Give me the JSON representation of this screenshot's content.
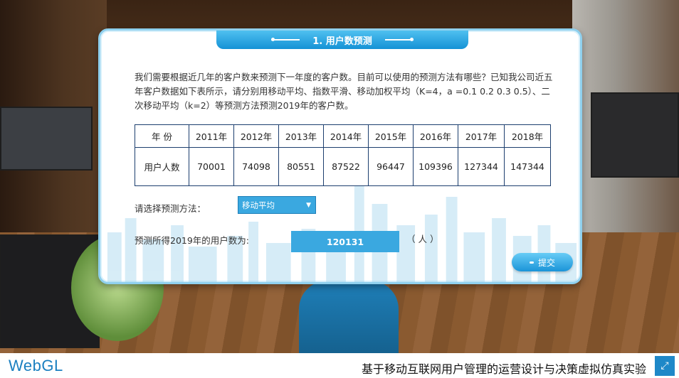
{
  "dialog": {
    "title": "1. 用户数预测",
    "question": "我们需要根据近几年的客户数来预测下一年度的客户数。目前可以使用的预测方法有哪些？已知我公司近五年客户数据如下表所示，请分别用移动平均、指数平滑、移动加权平均（K=4，a =0.1 0.2  0.3 0.5）、二次移动平均（k=2）等预测方法预测2019年的客户数。",
    "table": {
      "row1_header": "年 份",
      "years": [
        "2011年",
        "2012年",
        "2013年",
        "2014年",
        "2015年",
        "2016年",
        "2017年",
        "2018年"
      ],
      "row2_header": "用户人数",
      "users": [
        "70001",
        "74098",
        "80551",
        "87522",
        "96447",
        "109396",
        "127344",
        "147344"
      ]
    },
    "method_label": "请选择预测方法：",
    "method_selected": "移动平均",
    "result_label": "预测所得2019年的用户数为:",
    "result_value": "120131",
    "unit": "（ 人 ）",
    "submit_label": "提交"
  },
  "footer": {
    "brand": "WebGL",
    "project_title": "基于移动互联网用户管理的运营设计与决策虚拟仿真实验",
    "fullscreen_icon": "expand-icon"
  },
  "colors": {
    "accent": "#1592d6",
    "field_bg": "#3aa8e0",
    "table_border": "#1c3e6e"
  }
}
